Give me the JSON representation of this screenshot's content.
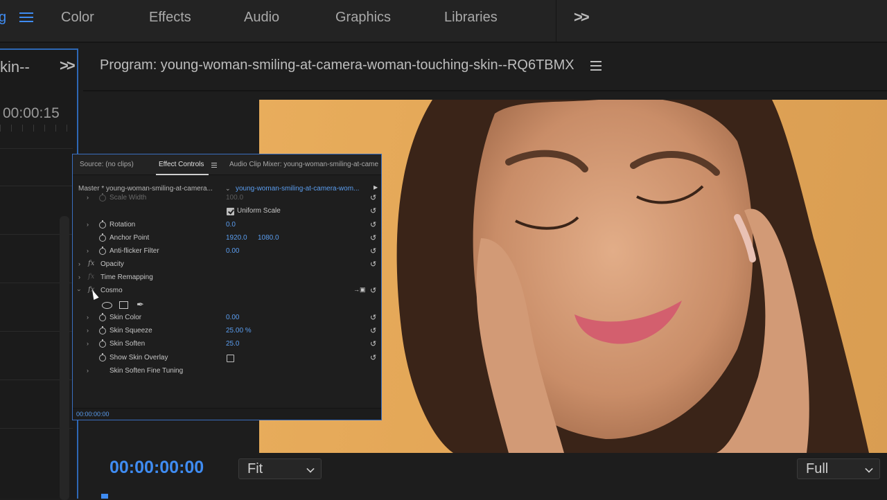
{
  "workspaces": {
    "partial_active": "g",
    "items": [
      "Color",
      "Effects",
      "Audio",
      "Graphics",
      "Libraries"
    ]
  },
  "left_panel": {
    "tab_label": "kin--",
    "timecode": "00:00:15"
  },
  "program": {
    "title": "Program: young-woman-smiling-at-camera-woman-touching-skin--RQ6TBMX",
    "timecode": "00:00:00:00",
    "zoom": "Fit",
    "resolution": "Full"
  },
  "effect_controls": {
    "tabs": {
      "source": "Source: (no clips)",
      "effect_controls": "Effect Controls",
      "audio_mixer": "Audio Clip Mixer: young-woman-smiling-at-came"
    },
    "master_label": "Master * young-woman-smiling-at-camera...",
    "clip_label": "young-woman-smiling-at-camera-wom...",
    "rows": {
      "scale_width": {
        "label": "Scale Width",
        "value": "100.0"
      },
      "uniform_scale": {
        "label": "Uniform Scale",
        "checked": true
      },
      "rotation": {
        "label": "Rotation",
        "value": "0.0"
      },
      "anchor_point": {
        "label": "Anchor Point",
        "x": "1920.0",
        "y": "1080.0"
      },
      "anti_flicker": {
        "label": "Anti-flicker Filter",
        "value": "0.00"
      },
      "opacity": {
        "label": "Opacity"
      },
      "time_remapping": {
        "label": "Time Remapping"
      },
      "cosmo": {
        "label": "Cosmo"
      },
      "skin_color": {
        "label": "Skin Color",
        "value": "0.00"
      },
      "skin_squeeze": {
        "label": "Skin Squeeze",
        "value": "25.00 %"
      },
      "skin_soften": {
        "label": "Skin Soften",
        "value": "25.0"
      },
      "show_skin_overlay": {
        "label": "Show Skin Overlay",
        "checked": false
      },
      "skin_soften_fine": {
        "label": "Skin Soften Fine Tuning"
      }
    },
    "footer_time": "00:00:00:00"
  },
  "colors": {
    "accent": "#3f8cf2",
    "value_blue": "#5b9ef0",
    "panel_bg": "#1e1e1e",
    "backdrop": "#e3a657"
  }
}
